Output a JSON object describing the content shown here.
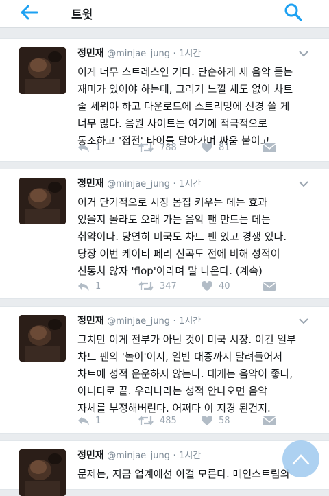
{
  "header": {
    "title": "트윗"
  },
  "tweets": [
    {
      "name": "정민재",
      "handle": "@minjae_jung",
      "separator": "·",
      "time": "1시간",
      "text": "이게 너무 스트레스인 거다. 단순하게 새 음악 듣는\n재미가 있어야 하는데, 그러거 느낄 새도 없이 차트\n줄 세워야 하고 다운로드에 스트리밍에 신경 쓸 게\n너무 많다. 음원 사이트는 여기에 적극적으로\n동조하고 '접전' 타이틀 달아가며 싸움 붙이고.",
      "reply_count": "1",
      "retweet_count": "788",
      "like_count": "81"
    },
    {
      "name": "정민재",
      "handle": "@minjae_jung",
      "separator": "·",
      "time": "1시간",
      "text": "이거 단기적으로 시장 몸집 키우는 데는 효과\n있을지 몰라도 오래 가는 음악 팬 만드는 데는\n취약이다. 당연히 미국도 차트 팬 있고 경쟁 있다.\n당장 이번 케이티 페리 신곡도 전에 비해 성적이\n신통치 않자 'flop'이라며 말 나온다. (계속)",
      "reply_count": "1",
      "retweet_count": "347",
      "like_count": "40"
    },
    {
      "name": "정민재",
      "handle": "@minjae_jung",
      "separator": "·",
      "time": "1시간",
      "text": "그치만 이게 전부가 아닌 것이 미국 시장. 이건 일부\n차트 팬의 '놀이'이지, 일반 대중까지 달려들어서\n차트에 성적 운운하지 않는다. 대개는 음악이 좋다,\n아니다로 끝. 우리나라는 성적 안나오면 음악\n자체를 부정해버린다. 어쩌다 이 지경 된건지.",
      "reply_count": "1",
      "retweet_count": "485",
      "like_count": "58"
    },
    {
      "name": "정민재",
      "handle": "@minjae_jung",
      "separator": "·",
      "time": "1시간",
      "text": "문제는, 지금 업계에선 이걸 모른다. 메인스트림의"
    }
  ]
}
